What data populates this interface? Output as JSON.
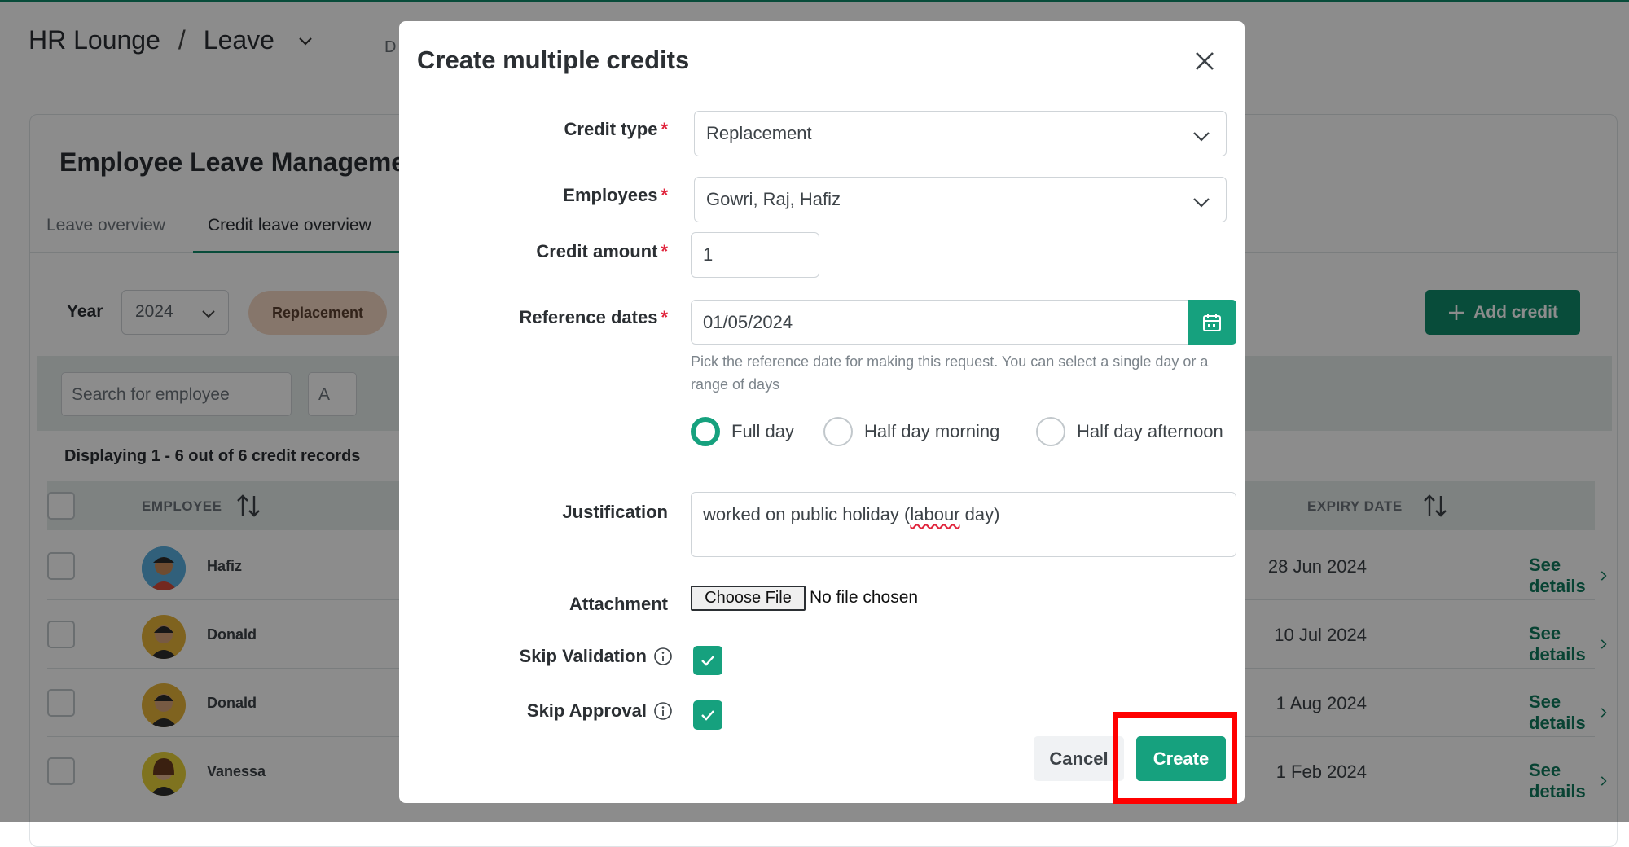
{
  "header": {
    "app": "HR Lounge",
    "separator": "/",
    "section": "Leave",
    "extra": "D"
  },
  "page": {
    "title": "Employee Leave Managemen",
    "tabs": [
      "Leave overview",
      "Credit leave overview"
    ],
    "year_label": "Year",
    "year_value": "2024",
    "type_pill": "Replacement",
    "add_credit_label": "Add credit",
    "search_placeholder": "Search for employee",
    "filter2_text": "A",
    "display_count": "Displaying 1 - 6 out of 6 credit records",
    "columns": {
      "employee": "EMPLOYEE",
      "expiry": "EXPIRY DATE"
    },
    "rows": [
      {
        "name": "Hafiz",
        "expiry": "28 Jun 2024",
        "action": "See details"
      },
      {
        "name": "Donald",
        "expiry": "10 Jul 2024",
        "action": "See details"
      },
      {
        "name": "Donald",
        "expiry": "1 Aug 2024",
        "action": "See details"
      },
      {
        "name": "Vanessa",
        "expiry": "1 Feb 2024",
        "action": "See details"
      }
    ]
  },
  "modal": {
    "title": "Create multiple credits",
    "credit_type_label": "Credit type",
    "credit_type_value": "Replacement",
    "employees_label": "Employees",
    "employees_value": "Gowri, Raj, Hafiz",
    "credit_amount_label": "Credit amount",
    "credit_amount_value": "1",
    "reference_dates_label": "Reference dates",
    "reference_dates_value": "01/05/2024",
    "hint": "Pick the reference date for making this request. You can select a single day or a range of days",
    "day_options": [
      "Full day",
      "Half day morning",
      "Half day afternoon"
    ],
    "selected_day_option": "Full day",
    "justification_label": "Justification",
    "justification_before": "worked on public holiday (",
    "justification_squiggle": "labour",
    "justification_after": " day)",
    "attachment_label": "Attachment",
    "choose_file_label": "Choose File",
    "no_file_text": "No file chosen",
    "skip_validation_label": "Skip Validation",
    "skip_validation_checked": true,
    "skip_approval_label": "Skip Approval",
    "skip_approval_checked": true,
    "required_mark": "*",
    "cancel_label": "Cancel",
    "create_label": "Create"
  },
  "colors": {
    "accent": "#16a17e",
    "accent_dark": "#0f8a6a",
    "required": "#e0243c",
    "highlight": "#ff0000"
  }
}
